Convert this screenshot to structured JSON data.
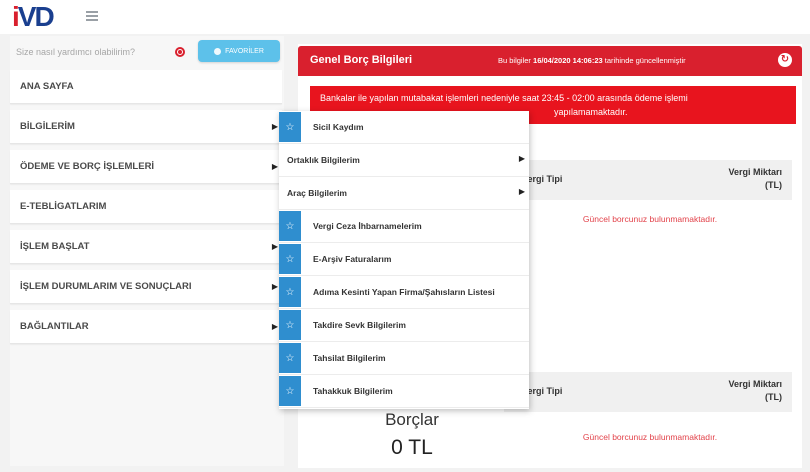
{
  "header": {
    "logo_text_i": "i",
    "logo_text_v": "V",
    "logo_text_d": "D"
  },
  "search": {
    "placeholder": "Size nasıl yardımcı olabilirim?",
    "favorites_label": "FAVORİLER"
  },
  "sidebar": {
    "items": [
      {
        "label": "ANA SAYFA",
        "has_submenu": false
      },
      {
        "label": "BİLGİLERİM",
        "has_submenu": true
      },
      {
        "label": "ÖDEME VE BORÇ İŞLEMLERİ",
        "has_submenu": true
      },
      {
        "label": "E-TEBLİGATLARIM",
        "has_submenu": false
      },
      {
        "label": "İŞLEM BAŞLAT",
        "has_submenu": true
      },
      {
        "label": "İŞLEM DURUMLARIM VE SONUÇLARI",
        "has_submenu": true
      },
      {
        "label": "BAĞLANTILAR",
        "has_submenu": true
      }
    ]
  },
  "panel": {
    "title": "Genel Borç Bilgileri",
    "update_prefix": "Bu bilgiler",
    "update_time": "16/04/2020 14:06:23",
    "update_suffix": "tarihinde güncellenmiştir",
    "alert_line1": "Bankalar ile yapılan mutabakat işlemleri nedeniyle saat 23:45 - 02:00 arasında ödeme işlemi",
    "alert_line2": "yapılamamaktadır.",
    "table1": {
      "col_type": "Vergi Tipi",
      "col_amount": "Vergi Miktarı (TL)",
      "empty": "Güncel borcunuz bulunmamaktadır."
    },
    "table2": {
      "col_type": "Vergi Tipi",
      "col_amount": "Vergi Miktarı (TL)",
      "empty": "Güncel borcunuz bulunmamaktadır."
    },
    "debt_label": "Borçlar",
    "debt_value": "0 TL"
  },
  "dropdown": {
    "items": [
      {
        "label": "Sicil Kaydım",
        "starred": true,
        "has_submenu": false
      },
      {
        "label": "Ortaklık Bilgilerim",
        "starred": false,
        "has_submenu": true
      },
      {
        "label": "Araç Bilgilerim",
        "starred": false,
        "has_submenu": true
      },
      {
        "label": "Vergi Ceza İhbarnamelerim",
        "starred": true,
        "has_submenu": false
      },
      {
        "label": "E-Arşiv Faturalarım",
        "starred": true,
        "has_submenu": false
      },
      {
        "label": "Adıma Kesinti Yapan Firma/Şahısların Listesi",
        "starred": true,
        "has_submenu": false
      },
      {
        "label": "Takdire Sevk Bilgilerim",
        "starred": true,
        "has_submenu": false
      },
      {
        "label": "Tahsilat Bilgilerim",
        "starred": true,
        "has_submenu": false
      },
      {
        "label": "Tahakkuk Bilgilerim",
        "starred": true,
        "has_submenu": false
      }
    ]
  },
  "colors": {
    "brand_red": "#d9202e",
    "alert_red": "#e8141e",
    "star_blue": "#2f8ecf",
    "favorites_blue": "#5dc1ea",
    "logo_blue": "#1a3f8f"
  },
  "icons": {
    "menu": "hamburger-icon",
    "search_target": "target-icon",
    "favorites": "star-icon",
    "refresh": "refresh-icon",
    "submenu": "chevron-right-icon",
    "dropdown_star": "star-icon"
  }
}
